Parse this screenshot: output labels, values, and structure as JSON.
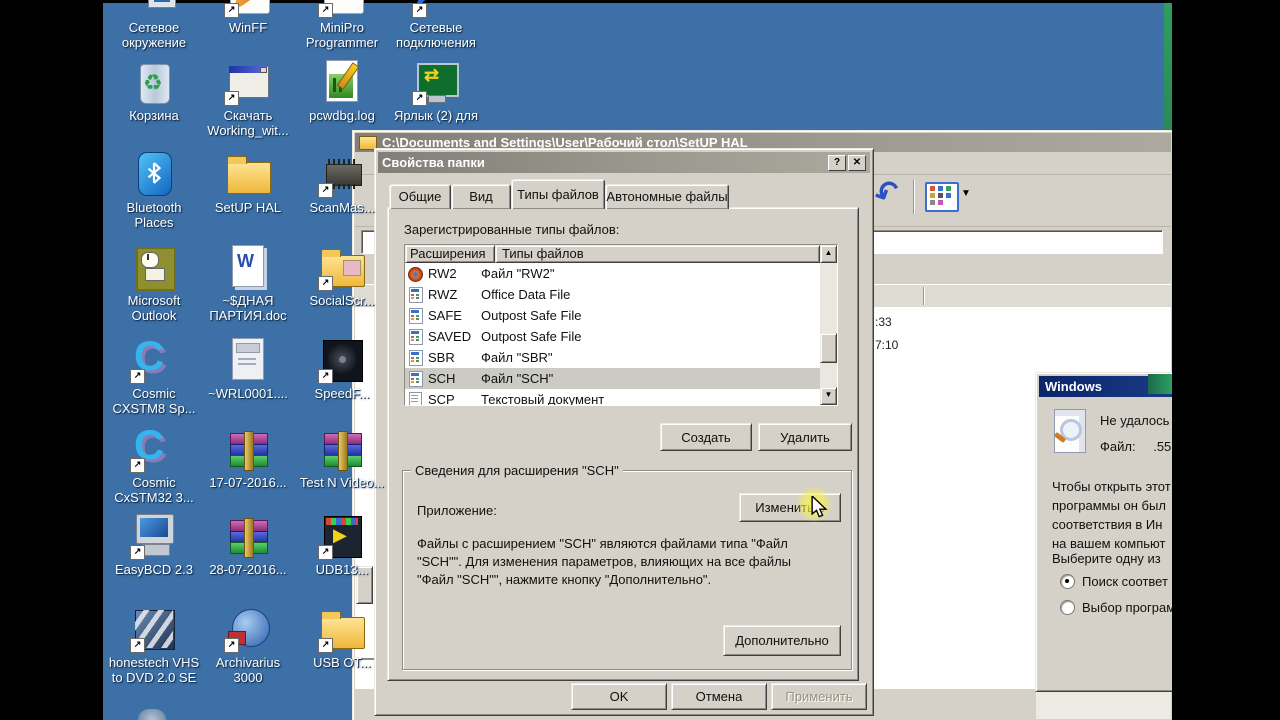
{
  "desktop": {
    "bg_color": "#3d70a6",
    "icons": [
      {
        "label": "Сетевое окружение",
        "kind": "net-places",
        "col": 1,
        "row": 1,
        "arrow": false
      },
      {
        "label": "WinFF",
        "kind": "winff",
        "col": 2,
        "row": 1,
        "arrow": true
      },
      {
        "label": "MiniPro Programmer",
        "kind": "minipro",
        "col": 3,
        "row": 1,
        "arrow": true
      },
      {
        "label": "Сетевые подключения",
        "kind": "net-conn",
        "col": 4,
        "row": 1,
        "arrow": true
      },
      {
        "label": "Корзина",
        "kind": "recycle",
        "col": 1,
        "row": 2,
        "arrow": false
      },
      {
        "label": "Скачать Working_wit...",
        "kind": "window-app",
        "col": 2,
        "row": 2,
        "arrow": true
      },
      {
        "label": "pcwdbg.log",
        "kind": "log-doc",
        "col": 3,
        "row": 2,
        "arrow": false
      },
      {
        "label": "Ярлык (2) для",
        "kind": "monitor-green",
        "col": 4,
        "row": 2,
        "arrow": true
      },
      {
        "label": "Bluetooth Places",
        "kind": "bluetooth",
        "col": 1,
        "row": 3,
        "arrow": false
      },
      {
        "label": "SetUP HAL",
        "kind": "folder",
        "col": 2,
        "row": 3,
        "arrow": false
      },
      {
        "label": "ScanMas...",
        "kind": "chip",
        "col": 3,
        "row": 3,
        "arrow": true
      },
      {
        "label": "Microsoft Outlook",
        "kind": "outlook",
        "col": 1,
        "row": 4,
        "arrow": false
      },
      {
        "label": "~$ДНАЯ ПАРТИЯ.doc",
        "kind": "word-doc",
        "col": 2,
        "row": 4,
        "arrow": false
      },
      {
        "label": "SocialScr...",
        "kind": "folder-pic",
        "col": 3,
        "row": 4,
        "arrow": true
      },
      {
        "label": "Cosmic CXSTM8 Sp...",
        "kind": "cosmic",
        "col": 1,
        "row": 5,
        "arrow": true
      },
      {
        "label": "~WRL0001....",
        "kind": "page-grey",
        "col": 2,
        "row": 5,
        "arrow": false
      },
      {
        "label": "SpeedF...",
        "kind": "fan",
        "col": 3,
        "row": 5,
        "arrow": true
      },
      {
        "label": "Cosmic CxSTM32 3...",
        "kind": "cosmic",
        "col": 1,
        "row": 6,
        "arrow": true
      },
      {
        "label": "17-07-2016...",
        "kind": "winrar",
        "col": 2,
        "row": 6,
        "arrow": false
      },
      {
        "label": "Test N Video...",
        "kind": "winrar",
        "col": 3,
        "row": 6,
        "arrow": false
      },
      {
        "label": "EasyBCD 2.3",
        "kind": "easybcd",
        "col": 1,
        "row": 7,
        "arrow": true
      },
      {
        "label": "28-07-2016...",
        "kind": "winrar",
        "col": 2,
        "row": 7,
        "arrow": false
      },
      {
        "label": "UDB13...",
        "kind": "media",
        "col": 3,
        "row": 7,
        "arrow": true
      },
      {
        "label": "honestech VHS to DVD 2.0 SE",
        "kind": "vhs",
        "col": 1,
        "row": 8,
        "arrow": true
      },
      {
        "label": "Archivarius 3000",
        "kind": "archivarius",
        "col": 2,
        "row": 8,
        "arrow": true
      },
      {
        "label": "USB OT...",
        "kind": "folder",
        "col": 3,
        "row": 8,
        "arrow": true
      }
    ]
  },
  "explorer": {
    "title": "C:\\Documents and Settings\\User\\Рабочий стол\\SetUP HAL",
    "toolbar_icons": [
      "undo-arrow-icon",
      "views-icon"
    ],
    "list_times": [
      ":33",
      "7:10"
    ]
  },
  "folder_options": {
    "title": "Свойства папки",
    "titlebar_buttons": {
      "help": "?",
      "close": "✕"
    },
    "tabs": [
      {
        "label": "Общие",
        "active": false
      },
      {
        "label": "Вид",
        "active": false
      },
      {
        "label": "Типы файлов",
        "active": true
      },
      {
        "label": "Автономные файлы",
        "active": false
      }
    ],
    "registered_label": "Зарегистрированные типы файлов:",
    "columns": [
      "Расширения",
      "Типы файлов"
    ],
    "rows": [
      {
        "ext": "RW2",
        "type": "Файл \"RW2\"",
        "icon": "rw2",
        "selected": false
      },
      {
        "ext": "RWZ",
        "type": "Office Data File",
        "icon": "office",
        "selected": false
      },
      {
        "ext": "SAFE",
        "type": "Outpost Safe File",
        "icon": "office",
        "selected": false
      },
      {
        "ext": "SAVED",
        "type": "Outpost Safe File",
        "icon": "office",
        "selected": false
      },
      {
        "ext": "SBR",
        "type": "Файл \"SBR\"",
        "icon": "office",
        "selected": false
      },
      {
        "ext": "SCH",
        "type": "Файл \"SCH\"",
        "icon": "office",
        "selected": true
      },
      {
        "ext": "SCP",
        "type": "Текстовый документ",
        "icon": "text",
        "selected": false
      }
    ],
    "buttons": {
      "create": "Создать",
      "delete": "Удалить",
      "change": "Изменить...",
      "advanced": "Дополнительно",
      "ok": "OK",
      "cancel": "Отмена",
      "apply": "Применить"
    },
    "group_title": "Сведения для расширения \"SCH\"",
    "application_label": "Приложение:",
    "description_lines": [
      "Файлы с расширением \"SCH\" являются файлами типа \"Файл",
      "\"SCH\"\". Для изменения параметров, влияющих на все файлы",
      "\"Файл \"SCH\"\", нажмите кнопку \"Дополнительно\"."
    ]
  },
  "windows_dialog": {
    "title": "Windows",
    "line1": "Не удалось",
    "file_label": "Файл:",
    "file_value": ".55",
    "body_lines": [
      "Чтобы открыть этот",
      "программы он был",
      "соответствия в Ин",
      "на вашем компьют"
    ],
    "choose_label": "Выберите одну из",
    "options": [
      {
        "label": "Поиск соответ",
        "selected": true
      },
      {
        "label": "Выбор програм",
        "selected": false
      }
    ]
  }
}
